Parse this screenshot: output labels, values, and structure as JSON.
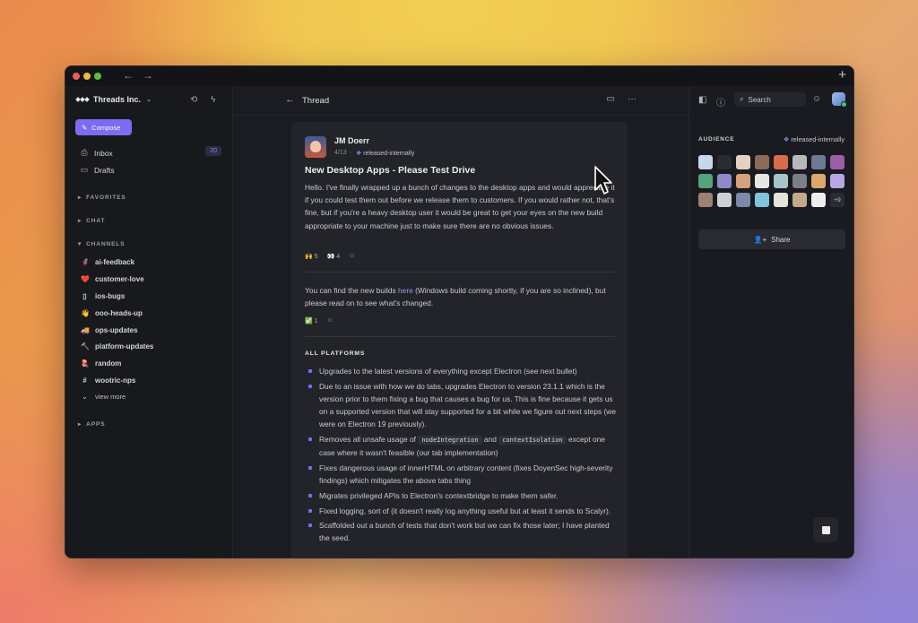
{
  "workspace": {
    "name": "Threads Inc.",
    "dropdown_icon": "chevron-down-icon"
  },
  "sidebar": {
    "compose_label": "Compose",
    "inbox": {
      "label": "Inbox",
      "count": "20"
    },
    "drafts": {
      "label": "Drafts"
    },
    "sections": {
      "favorites": "FAVORITES",
      "chat": "CHAT",
      "channels": "CHANNELS",
      "apps": "APPS"
    },
    "channels": [
      {
        "label": "ai-feedback",
        "icon": "🦸"
      },
      {
        "label": "customer-love",
        "icon": "❤️"
      },
      {
        "label": "ios-bugs",
        "icon": "▯"
      },
      {
        "label": "ooo-heads-up",
        "icon": "👋"
      },
      {
        "label": "ops-updates",
        "icon": "🚚"
      },
      {
        "label": "platform-updates",
        "icon": "🔨"
      },
      {
        "label": "random",
        "icon": "🪼"
      },
      {
        "label": "wootric-nps",
        "icon": "#"
      }
    ],
    "view_more": "view more"
  },
  "thread": {
    "title": "Thread",
    "author": "JM Doerr",
    "date": "4/13",
    "channel": "released-internally",
    "post_title": "New Desktop Apps - Please Test Drive",
    "body": "Hello. I've finally wrapped up a bunch of changes to the desktop apps and would appreciate it if you could test them out before we release them to customers. If you would rather not, that's fine, but if you're a heavy desktop user it would be great to get your eyes on the new build appropriate to your machine just to make sure there are no obvious issues.",
    "reactions1": [
      {
        "emoji": "🙌",
        "count": "5"
      },
      {
        "emoji": "👀",
        "count": "4"
      }
    ],
    "reply_before_link": "You can find the new builds ",
    "reply_link": "here",
    "reply_after_link": " (Windows build coming shortly, if you are so inclined), but please read on to see what's changed.",
    "reactions2": [
      {
        "emoji": "✅",
        "count": "1"
      }
    ],
    "section_heading": "ALL PLATFORMS",
    "bullets": {
      "b1": "Upgrades to the latest versions of everything except Electron (see next bullet)",
      "b2": "Due to an issue with how we do tabs, upgrades Electron to version 23.1.1 which is the version prior to them fixing a bug that causes a bug for us. This is fine because it gets us on a supported version that will stay supported for a bit while we figure out next steps (we were on Electron 19 previously).",
      "b3_pre": "Removes all unsafe usage of ",
      "b3_code1": "nodeIntegration",
      "b3_mid": " and ",
      "b3_code2": "contextIsolation",
      "b3_post": " except one case where it wasn't feasible (our tab implementation)",
      "b4": "Fixes dangerous usage of innerHTML on arbitrary content (fixes DoyenSec high-severity findings) which mitigates the above tabs thing",
      "b5": "Migrates privileged APIs to Electron's contextbridge to make them safer.",
      "b6": "Fixed logging, sort of (it doesn't really log anything useful but at least it sends to Scalyr).",
      "b7": "Scaffolded out a bunch of tests that don't work but we can fix those later; I have planted the seed."
    }
  },
  "right_panel": {
    "search_placeholder": "Search",
    "audience_label": "AUDIENCE",
    "audience_channel": "released-internally",
    "more_count": "+9",
    "share_label": "Share"
  },
  "colors": {
    "accent": "#7b6cf2",
    "link": "#9d94f4",
    "background": "#1b1c21"
  }
}
